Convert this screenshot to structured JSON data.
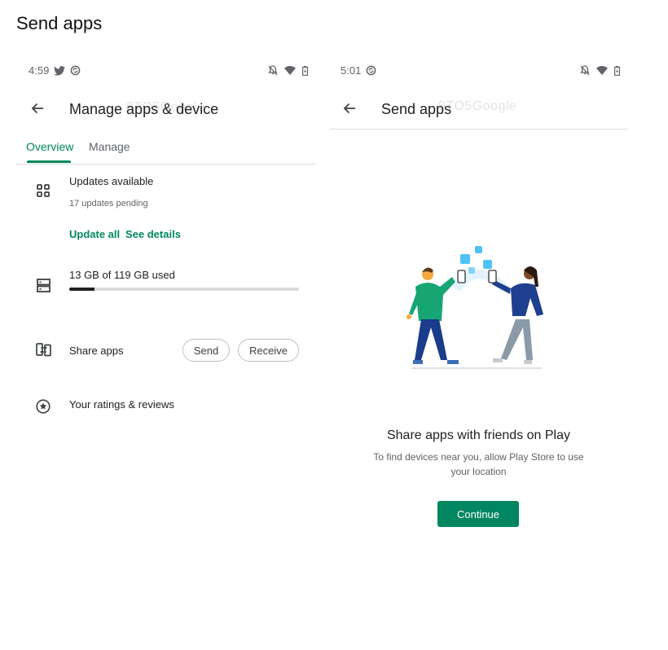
{
  "page": {
    "title": "Send apps"
  },
  "watermark": "9TO5Google",
  "left_screen": {
    "status": {
      "time": "4:59"
    },
    "topbar": {
      "title": "Manage apps & device"
    },
    "tabs": [
      {
        "label": "Overview",
        "active": true
      },
      {
        "label": "Manage",
        "active": false
      }
    ],
    "updates": {
      "title": "Updates available",
      "subtitle": "17 updates pending",
      "update_all": "Update all",
      "see_details": "See details"
    },
    "storage": {
      "label": "13 GB of 119 GB used",
      "used_fraction": 0.109
    },
    "share": {
      "label": "Share apps",
      "send": "Send",
      "receive": "Receive"
    },
    "ratings": {
      "label": "Your ratings & reviews"
    }
  },
  "right_screen": {
    "status": {
      "time": "5:01"
    },
    "topbar": {
      "title": "Send apps"
    },
    "headline": "Share apps with friends on Play",
    "description_line1": "To find devices near you, allow Play Store to use",
    "description_line2": "your location",
    "continue": "Continue"
  },
  "colors": {
    "accent": "#01875f",
    "text": "#202124",
    "secondary": "#5f6368"
  },
  "icons": {
    "twitter": "twitter-icon",
    "sync": "sync-circle-icon",
    "dnd": "notifications-off-icon",
    "wifi": "wifi-icon",
    "battery": "battery-icon",
    "back": "arrow-back-icon",
    "updates": "apps-grid-icon",
    "storage": "storage-icon",
    "share": "share-devices-icon",
    "ratings": "star-circle-icon"
  }
}
